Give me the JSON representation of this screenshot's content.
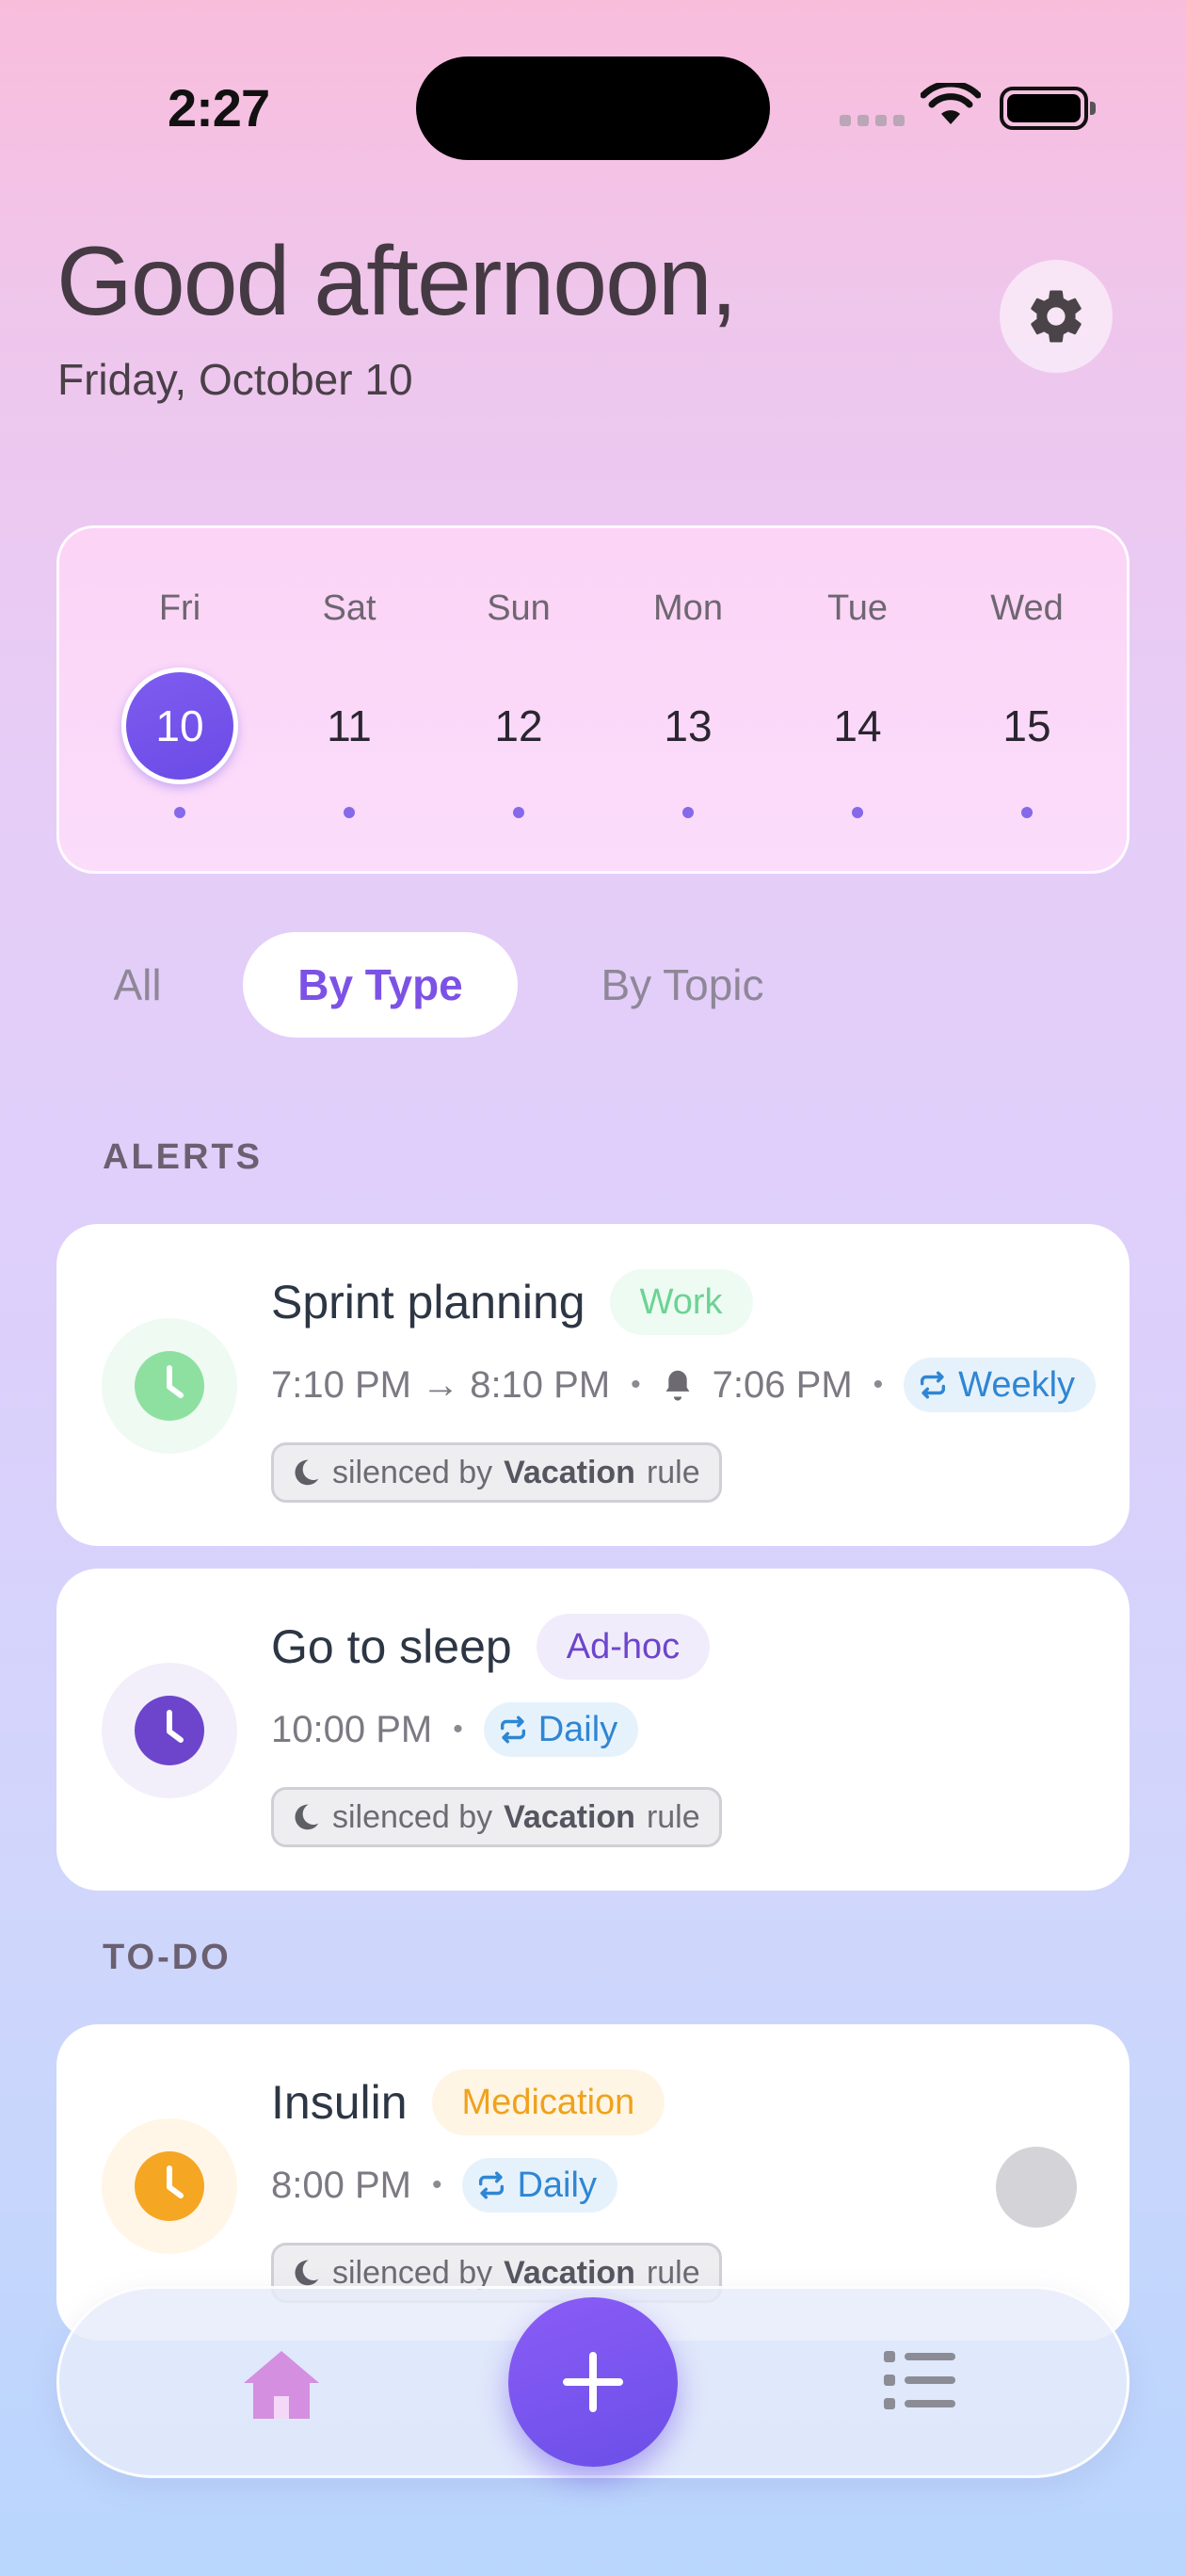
{
  "status_bar": {
    "time": "2:27"
  },
  "header": {
    "greeting": "Good afternoon,",
    "date": "Friday, October 10"
  },
  "calendar": {
    "days": [
      {
        "dow": "Fri",
        "num": "10",
        "selected": true
      },
      {
        "dow": "Sat",
        "num": "11"
      },
      {
        "dow": "Sun",
        "num": "12"
      },
      {
        "dow": "Mon",
        "num": "13"
      },
      {
        "dow": "Tue",
        "num": "14"
      },
      {
        "dow": "Wed",
        "num": "15"
      }
    ]
  },
  "tabs": [
    {
      "label": "All"
    },
    {
      "label": "By Type",
      "active": true
    },
    {
      "label": "By Topic"
    }
  ],
  "sections": {
    "alerts": {
      "header": "ALERTS",
      "items": [
        {
          "title": "Sprint planning",
          "tag": "Work",
          "tag_color": "#6cd394",
          "time": "7:10 PM → 8:10 PM",
          "alert_time": "7:06 PM",
          "repeat": "Weekly",
          "silenced_prefix": "silenced by",
          "silenced_rule": "Vacation",
          "silenced_suffix": "rule",
          "icon_color": "#8ee0a1"
        },
        {
          "title": "Go to sleep",
          "tag": "Ad-hoc",
          "tag_color": "#6d45cc",
          "time": "10:00 PM",
          "repeat": "Daily",
          "silenced_prefix": "silenced by",
          "silenced_rule": "Vacation",
          "silenced_suffix": "rule",
          "icon_color": "#6d45cc"
        }
      ]
    },
    "todo": {
      "header": "TO-DO",
      "items": [
        {
          "title": "Insulin",
          "tag": "Medication",
          "tag_color": "#f0a21c",
          "time": "8:00 PM",
          "repeat": "Daily",
          "silenced_prefix": "silenced by",
          "silenced_rule": "Vacation",
          "silenced_suffix": "rule",
          "icon_color": "#f5a623"
        }
      ]
    }
  },
  "icons": {
    "settings": "gear-icon",
    "home": "home-icon",
    "add": "plus-icon",
    "list": "list-icon",
    "alert_item": "clock-icon",
    "bell": "bell-icon",
    "repeat": "repeat-icon",
    "silenced": "moon-icon"
  }
}
